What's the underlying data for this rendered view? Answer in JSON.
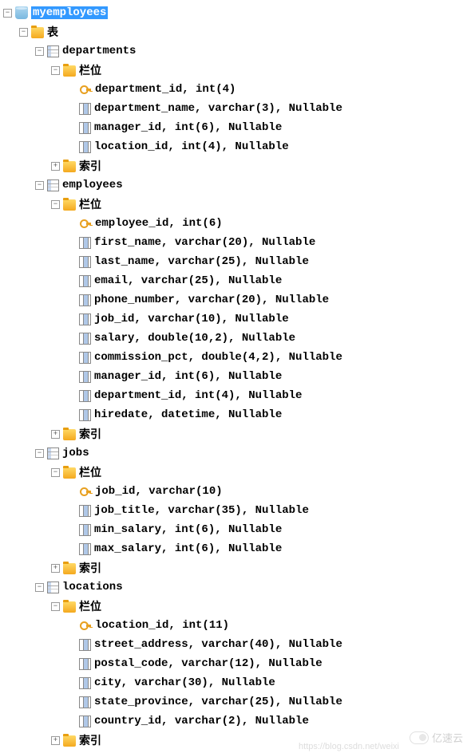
{
  "database": {
    "name": "myemployees"
  },
  "root_folder": "表",
  "columns_label": "栏位",
  "index_label": "索引",
  "tables": [
    {
      "name": "departments",
      "columns": [
        {
          "def": "department_id, int(4)",
          "pk": true
        },
        {
          "def": "department_name, varchar(3), Nullable",
          "pk": false
        },
        {
          "def": "manager_id, int(6), Nullable",
          "pk": false
        },
        {
          "def": "location_id, int(4), Nullable",
          "pk": false
        }
      ]
    },
    {
      "name": "employees",
      "columns": [
        {
          "def": "employee_id, int(6)",
          "pk": true
        },
        {
          "def": "first_name, varchar(20), Nullable",
          "pk": false
        },
        {
          "def": "last_name, varchar(25), Nullable",
          "pk": false
        },
        {
          "def": "email, varchar(25), Nullable",
          "pk": false
        },
        {
          "def": "phone_number, varchar(20), Nullable",
          "pk": false
        },
        {
          "def": "job_id, varchar(10), Nullable",
          "pk": false
        },
        {
          "def": "salary, double(10,2), Nullable",
          "pk": false
        },
        {
          "def": "commission_pct, double(4,2), Nullable",
          "pk": false
        },
        {
          "def": "manager_id, int(6), Nullable",
          "pk": false
        },
        {
          "def": "department_id, int(4), Nullable",
          "pk": false
        },
        {
          "def": "hiredate, datetime, Nullable",
          "pk": false
        }
      ]
    },
    {
      "name": "jobs",
      "columns": [
        {
          "def": "job_id, varchar(10)",
          "pk": true
        },
        {
          "def": "job_title, varchar(35), Nullable",
          "pk": false
        },
        {
          "def": "min_salary, int(6), Nullable",
          "pk": false
        },
        {
          "def": "max_salary, int(6), Nullable",
          "pk": false
        }
      ]
    },
    {
      "name": "locations",
      "columns": [
        {
          "def": "location_id, int(11)",
          "pk": true
        },
        {
          "def": "street_address, varchar(40), Nullable",
          "pk": false
        },
        {
          "def": "postal_code, varchar(12), Nullable",
          "pk": false
        },
        {
          "def": "city, varchar(30), Nullable",
          "pk": false
        },
        {
          "def": "state_province, varchar(25), Nullable",
          "pk": false
        },
        {
          "def": "country_id, varchar(2), Nullable",
          "pk": false
        }
      ]
    }
  ],
  "watermark": {
    "text": "亿速云",
    "url": "https://blog.csdn.net/weixi"
  }
}
